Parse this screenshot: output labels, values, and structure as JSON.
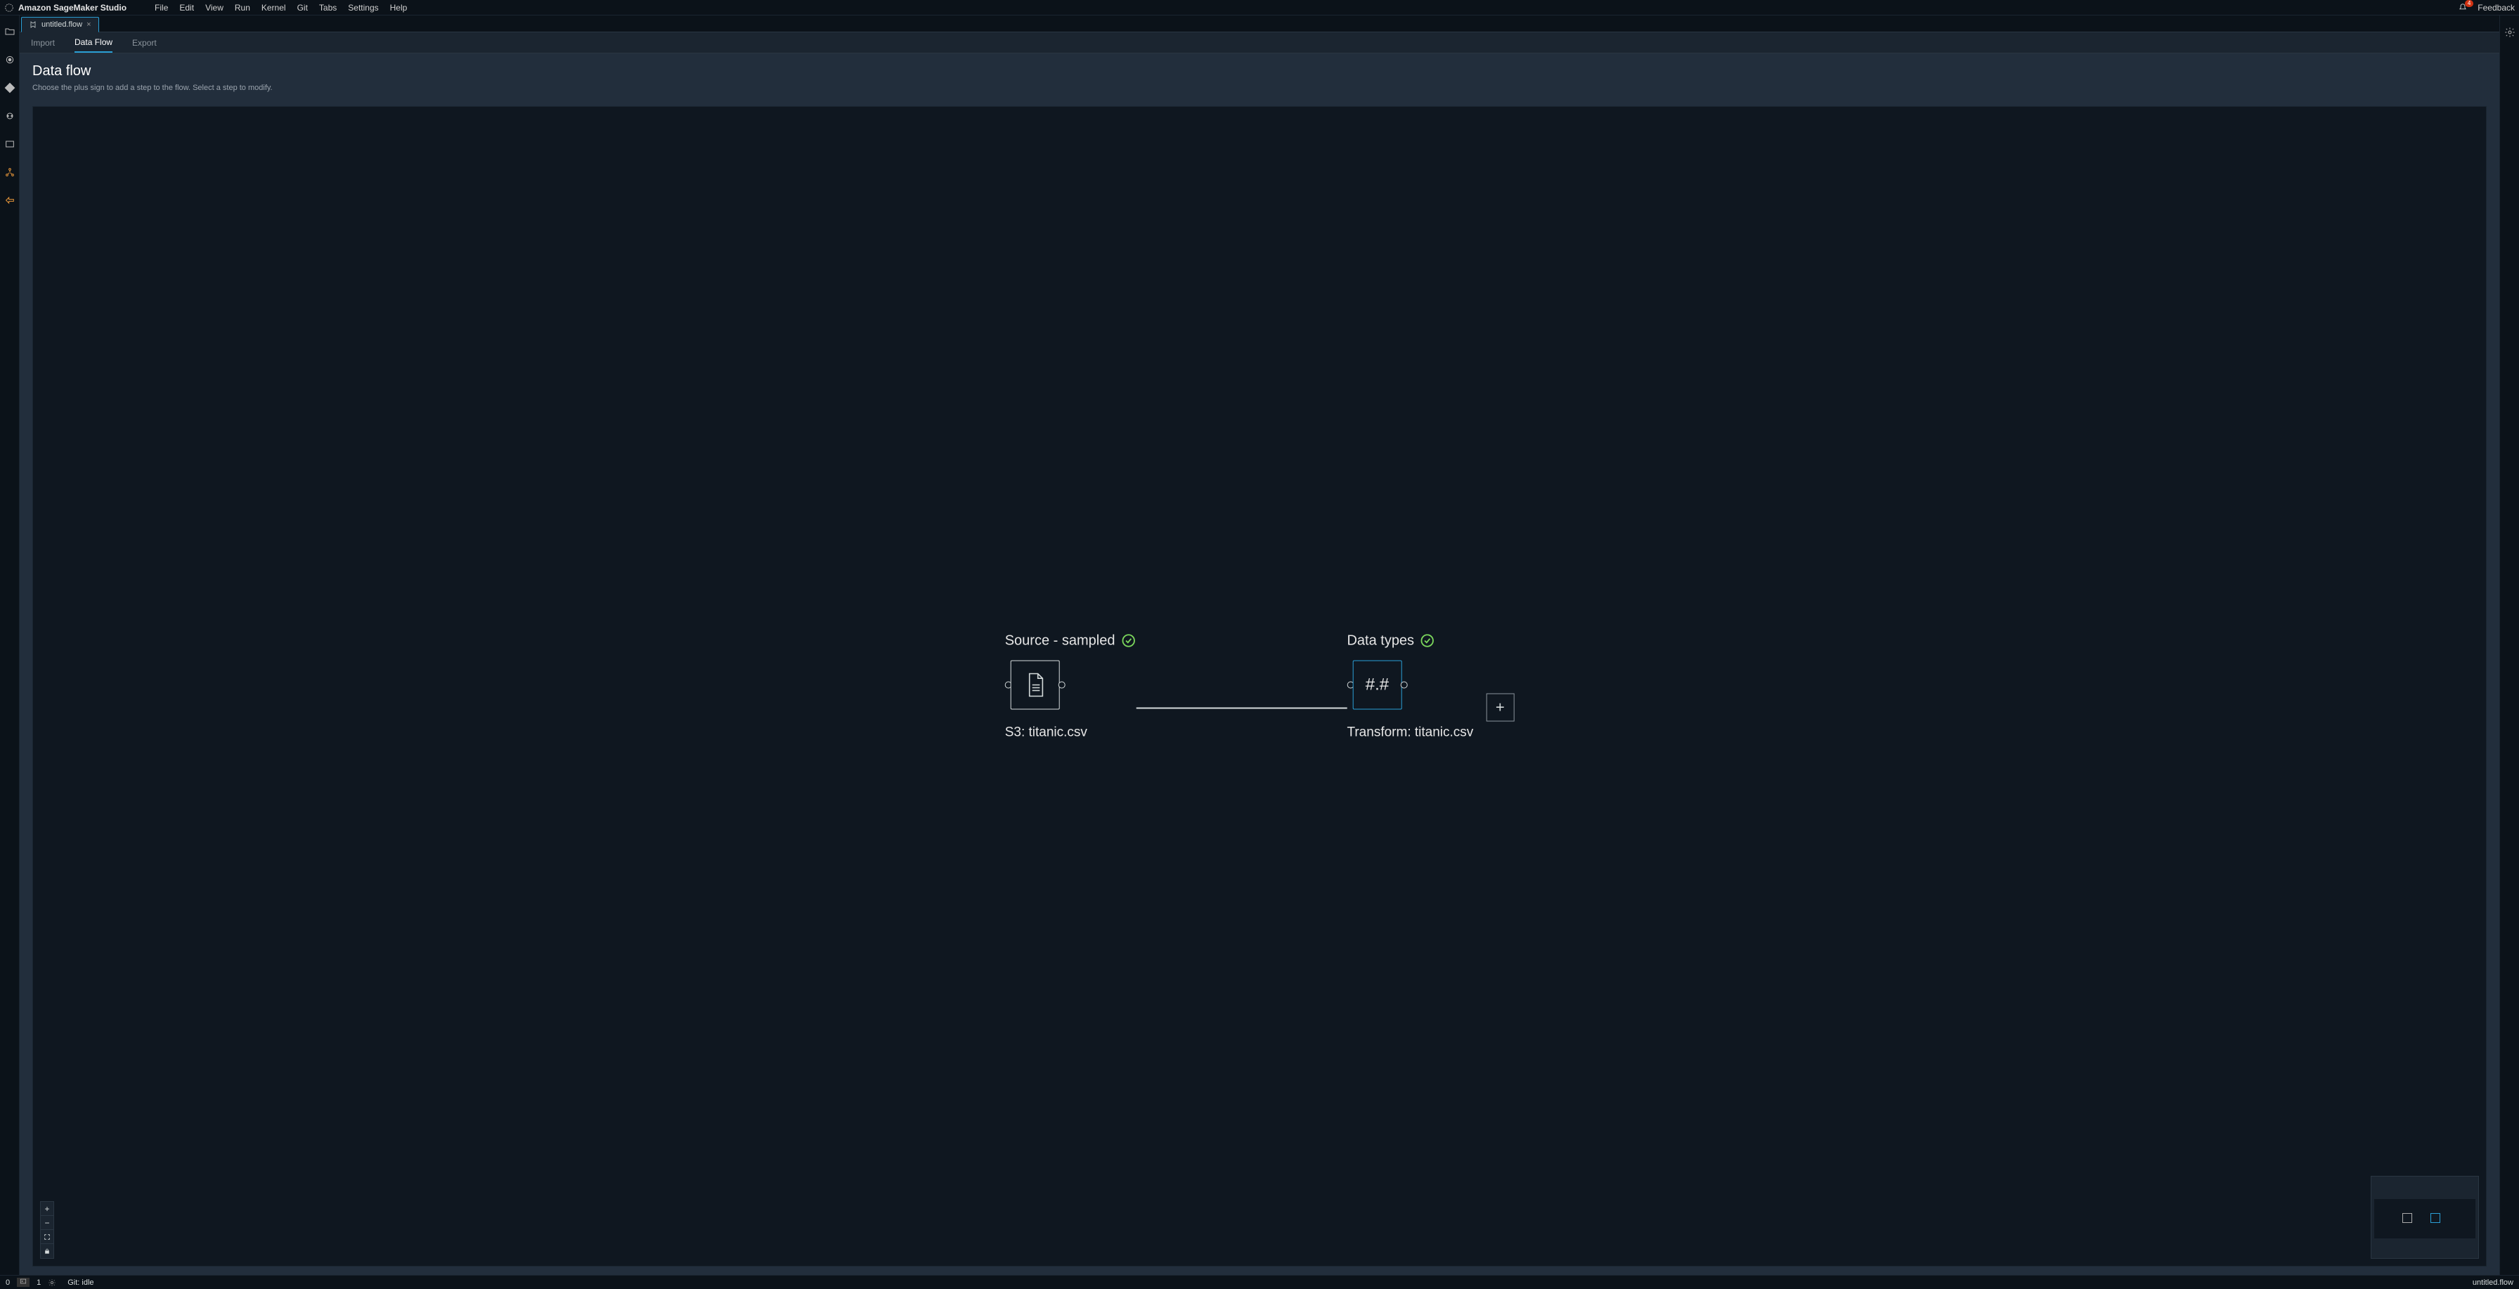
{
  "app": {
    "title": "Amazon SageMaker Studio"
  },
  "menu": {
    "items": [
      "File",
      "Edit",
      "View",
      "Run",
      "Kernel",
      "Git",
      "Tabs",
      "Settings",
      "Help"
    ],
    "notifications_count": "4",
    "feedback": "Feedback"
  },
  "tab": {
    "name": "untitled.flow"
  },
  "subtabs": {
    "import": "Import",
    "dataflow": "Data Flow",
    "export": "Export"
  },
  "page": {
    "title": "Data flow",
    "subtitle": "Choose the plus sign to add a step to the flow. Select a step to modify."
  },
  "flow": {
    "node1_title": "Source - sampled",
    "node1_sub": "S3: titanic.csv",
    "node2_title": "Data types",
    "node2_glyph": "#.#",
    "node2_sub": "Transform: titanic.csv"
  },
  "status": {
    "zero": "0",
    "one": "1",
    "git": "Git: idle",
    "filename": "untitled.flow"
  }
}
